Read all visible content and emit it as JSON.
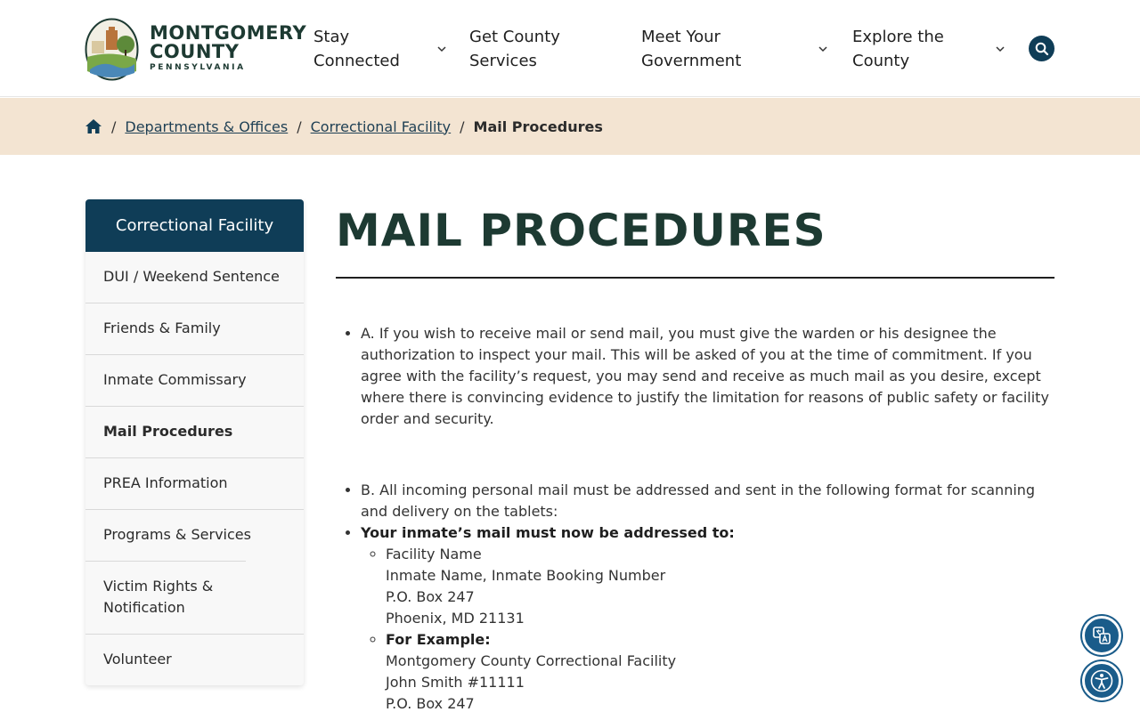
{
  "logo": {
    "line1": "MONTGOMERY",
    "line2": "COUNTY",
    "line3": "PENNSYLVANIA"
  },
  "nav": {
    "items": [
      {
        "label": "Stay Connected",
        "has_dropdown": true
      },
      {
        "label": "Get County Services",
        "has_dropdown": false
      },
      {
        "label": "Meet Your Government",
        "has_dropdown": true
      },
      {
        "label": "Explore the County",
        "has_dropdown": true
      }
    ],
    "search_icon": "search-icon"
  },
  "breadcrumb": {
    "home_icon": "home-icon",
    "items": [
      {
        "label": "Departments & Offices",
        "link": true
      },
      {
        "label": "Correctional Facility",
        "link": true
      },
      {
        "label": "Mail Procedures",
        "link": false
      }
    ]
  },
  "sidebar": {
    "title": "Correctional Facility",
    "items": [
      {
        "label": "DUI / Weekend Sentence",
        "active": false
      },
      {
        "label": "Friends & Family",
        "active": false
      },
      {
        "label": "Inmate Commissary",
        "active": false
      },
      {
        "label": "Mail Procedures",
        "active": true
      },
      {
        "label": "PREA Information",
        "active": false
      },
      {
        "label": "Programs & Services",
        "active": false
      },
      {
        "label": "Victim Rights & Notification",
        "active": false
      },
      {
        "label": "Volunteer",
        "active": false
      }
    ]
  },
  "main": {
    "title": "MAIL PROCEDURES",
    "para_a": "A. If you wish to receive mail or send mail, you must give the warden or his designee the authorization to inspect your mail. This will be asked of you at the time of commitment. If you agree with the facility’s request, you may send and receive as much mail as you desire, except where there is convincing evidence to justify the limitation for reasons of public safety or facility order and security.",
    "para_b": "B. All incoming personal mail must be addressed and sent in the following format for scanning and delivery on the tablets:",
    "address_heading": "Your inmate’s mail must now be addressed to:",
    "format_lines": [
      "Facility Name",
      "Inmate Name, Inmate Booking Number",
      "P.O. Box 247",
      "Phoenix, MD 21131"
    ],
    "example_heading": "For Example:",
    "example_lines": [
      "Montgomery County Correctional Facility",
      "John Smith #11111",
      "P.O. Box 247"
    ]
  },
  "floating": {
    "translate_icon": "translate-icon",
    "accessibility_icon": "accessibility-icon"
  },
  "colors": {
    "brand_navy": "#0f3d57",
    "title_green": "#1d3a32",
    "breadcrumb_bg": "#f3e4d2",
    "float_blue": "#1a5c8a"
  }
}
